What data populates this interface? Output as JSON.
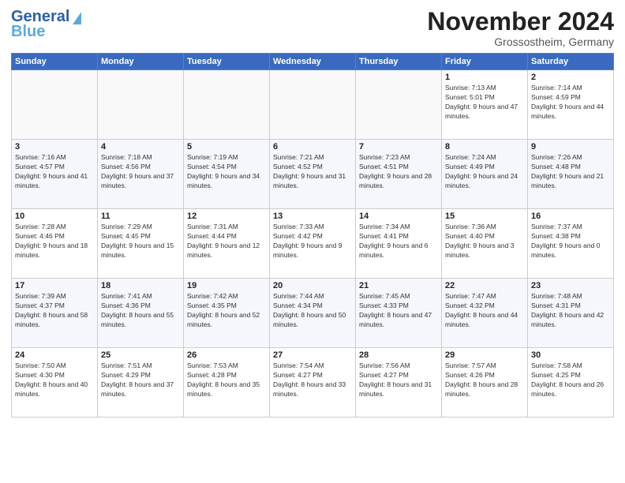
{
  "header": {
    "logo_general": "General",
    "logo_blue": "Blue",
    "month_title": "November 2024",
    "location": "Grossostheim, Germany"
  },
  "columns": [
    "Sunday",
    "Monday",
    "Tuesday",
    "Wednesday",
    "Thursday",
    "Friday",
    "Saturday"
  ],
  "weeks": [
    [
      {
        "day": "",
        "info": ""
      },
      {
        "day": "",
        "info": ""
      },
      {
        "day": "",
        "info": ""
      },
      {
        "day": "",
        "info": ""
      },
      {
        "day": "",
        "info": ""
      },
      {
        "day": "1",
        "info": "Sunrise: 7:13 AM\nSunset: 5:01 PM\nDaylight: 9 hours and 47 minutes."
      },
      {
        "day": "2",
        "info": "Sunrise: 7:14 AM\nSunset: 4:59 PM\nDaylight: 9 hours and 44 minutes."
      }
    ],
    [
      {
        "day": "3",
        "info": "Sunrise: 7:16 AM\nSunset: 4:57 PM\nDaylight: 9 hours and 41 minutes."
      },
      {
        "day": "4",
        "info": "Sunrise: 7:18 AM\nSunset: 4:56 PM\nDaylight: 9 hours and 37 minutes."
      },
      {
        "day": "5",
        "info": "Sunrise: 7:19 AM\nSunset: 4:54 PM\nDaylight: 9 hours and 34 minutes."
      },
      {
        "day": "6",
        "info": "Sunrise: 7:21 AM\nSunset: 4:52 PM\nDaylight: 9 hours and 31 minutes."
      },
      {
        "day": "7",
        "info": "Sunrise: 7:23 AM\nSunset: 4:51 PM\nDaylight: 9 hours and 28 minutes."
      },
      {
        "day": "8",
        "info": "Sunrise: 7:24 AM\nSunset: 4:49 PM\nDaylight: 9 hours and 24 minutes."
      },
      {
        "day": "9",
        "info": "Sunrise: 7:26 AM\nSunset: 4:48 PM\nDaylight: 9 hours and 21 minutes."
      }
    ],
    [
      {
        "day": "10",
        "info": "Sunrise: 7:28 AM\nSunset: 4:46 PM\nDaylight: 9 hours and 18 minutes."
      },
      {
        "day": "11",
        "info": "Sunrise: 7:29 AM\nSunset: 4:45 PM\nDaylight: 9 hours and 15 minutes."
      },
      {
        "day": "12",
        "info": "Sunrise: 7:31 AM\nSunset: 4:44 PM\nDaylight: 9 hours and 12 minutes."
      },
      {
        "day": "13",
        "info": "Sunrise: 7:33 AM\nSunset: 4:42 PM\nDaylight: 9 hours and 9 minutes."
      },
      {
        "day": "14",
        "info": "Sunrise: 7:34 AM\nSunset: 4:41 PM\nDaylight: 9 hours and 6 minutes."
      },
      {
        "day": "15",
        "info": "Sunrise: 7:36 AM\nSunset: 4:40 PM\nDaylight: 9 hours and 3 minutes."
      },
      {
        "day": "16",
        "info": "Sunrise: 7:37 AM\nSunset: 4:38 PM\nDaylight: 9 hours and 0 minutes."
      }
    ],
    [
      {
        "day": "17",
        "info": "Sunrise: 7:39 AM\nSunset: 4:37 PM\nDaylight: 8 hours and 58 minutes."
      },
      {
        "day": "18",
        "info": "Sunrise: 7:41 AM\nSunset: 4:36 PM\nDaylight: 8 hours and 55 minutes."
      },
      {
        "day": "19",
        "info": "Sunrise: 7:42 AM\nSunset: 4:35 PM\nDaylight: 8 hours and 52 minutes."
      },
      {
        "day": "20",
        "info": "Sunrise: 7:44 AM\nSunset: 4:34 PM\nDaylight: 8 hours and 50 minutes."
      },
      {
        "day": "21",
        "info": "Sunrise: 7:45 AM\nSunset: 4:33 PM\nDaylight: 8 hours and 47 minutes."
      },
      {
        "day": "22",
        "info": "Sunrise: 7:47 AM\nSunset: 4:32 PM\nDaylight: 8 hours and 44 minutes."
      },
      {
        "day": "23",
        "info": "Sunrise: 7:48 AM\nSunset: 4:31 PM\nDaylight: 8 hours and 42 minutes."
      }
    ],
    [
      {
        "day": "24",
        "info": "Sunrise: 7:50 AM\nSunset: 4:30 PM\nDaylight: 8 hours and 40 minutes."
      },
      {
        "day": "25",
        "info": "Sunrise: 7:51 AM\nSunset: 4:29 PM\nDaylight: 8 hours and 37 minutes."
      },
      {
        "day": "26",
        "info": "Sunrise: 7:53 AM\nSunset: 4:28 PM\nDaylight: 8 hours and 35 minutes."
      },
      {
        "day": "27",
        "info": "Sunrise: 7:54 AM\nSunset: 4:27 PM\nDaylight: 8 hours and 33 minutes."
      },
      {
        "day": "28",
        "info": "Sunrise: 7:56 AM\nSunset: 4:27 PM\nDaylight: 8 hours and 31 minutes."
      },
      {
        "day": "29",
        "info": "Sunrise: 7:57 AM\nSunset: 4:26 PM\nDaylight: 8 hours and 28 minutes."
      },
      {
        "day": "30",
        "info": "Sunrise: 7:58 AM\nSunset: 4:25 PM\nDaylight: 8 hours and 26 minutes."
      }
    ]
  ]
}
